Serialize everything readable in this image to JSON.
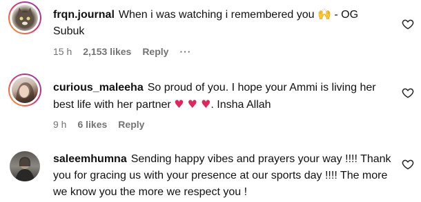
{
  "comments": [
    {
      "username": "frqn.journal",
      "text": "When i was watching i remembered you",
      "emoji": "🙌",
      "text_after": " - OG Subuk",
      "time": "15 h",
      "likes": "2,153 likes",
      "reply": "Reply",
      "more": "···"
    },
    {
      "username": "curious_maleeha",
      "text": "So proud of you. I hope your Ammi is living her best life with her partner",
      "emoji": "♥ ♥ ♥",
      "text_after": ". Insha Allah",
      "time": "9 h",
      "likes": "6 likes",
      "reply": "Reply"
    },
    {
      "username": "saleemhumna",
      "text": "Sending happy vibes and prayers your way !!!! Thank you for gracing us with your presence at our sports day !!!! The more we know you the more we respect you !"
    }
  ],
  "icons": {
    "like": "heart-outline-icon",
    "more": "more-horizontal-icon"
  }
}
